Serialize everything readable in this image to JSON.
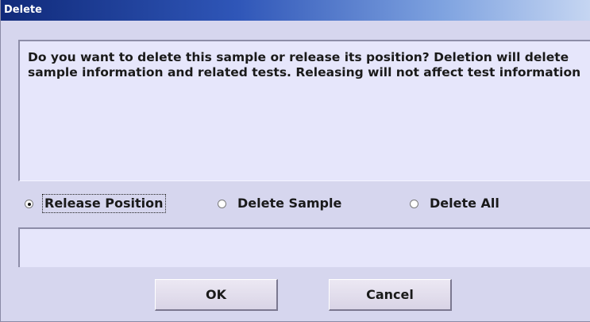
{
  "window": {
    "title": "Delete"
  },
  "message": {
    "text": "Do you want to delete this sample or release its position? Deletion will delete sample information and related tests. Releasing will not affect test information"
  },
  "options": {
    "selected": "Release Position",
    "items": [
      {
        "label": "Release Position",
        "checked": true
      },
      {
        "label": "Delete Sample",
        "checked": false
      },
      {
        "label": "Delete All",
        "checked": false
      }
    ]
  },
  "status": {
    "text": ""
  },
  "buttons": {
    "ok_label": "OK",
    "cancel_label": "Cancel"
  },
  "colors": {
    "dialog_background": "#d6d6ee",
    "panel_background": "#e6e6fb",
    "titlebar_start": "#102a7a",
    "titlebar_end": "#c6d6f2"
  },
  "icons": {
    "radio_checked": "radio-checked-icon",
    "radio_unchecked": "radio-unchecked-icon"
  }
}
